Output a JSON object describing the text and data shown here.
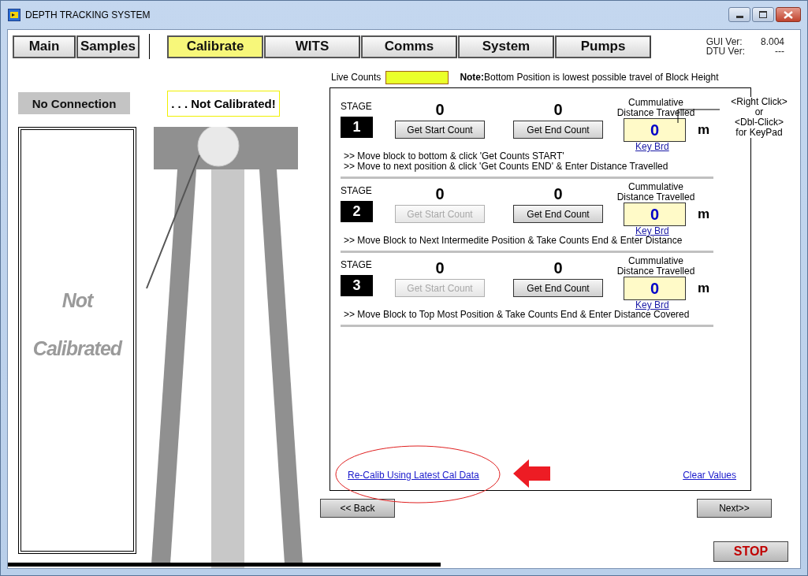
{
  "window": {
    "title": "DEPTH TRACKING SYSTEM"
  },
  "tab_groups": [
    {
      "tabs": [
        {
          "label": "Main",
          "selected": false
        },
        {
          "label": "Samples",
          "selected": false
        }
      ]
    },
    {
      "tabs": [
        {
          "label": "Calibrate",
          "selected": true
        },
        {
          "label": "WITS",
          "selected": false
        },
        {
          "label": "Comms",
          "selected": false
        },
        {
          "label": "System",
          "selected": false
        },
        {
          "label": "Pumps",
          "selected": false
        }
      ]
    }
  ],
  "versions": [
    {
      "label": "GUI Ver:",
      "value": "8.004"
    },
    {
      "label": "DTU Ver:",
      "value": "---"
    }
  ],
  "connection_status": "No Connection",
  "calibration_status": ". . . Not Calibrated!",
  "gauge_panel": {
    "lines": [
      "Not",
      "Calibrated"
    ]
  },
  "live_counts": {
    "label": "Live Counts"
  },
  "note": "**Note:**Bottom Position is lowest possible travel of Block Height",
  "callout": [
    "<Right Click>",
    "or",
    "<Dbl-Click>",
    "for KeyPad"
  ],
  "stages": [
    {
      "label": "STAGE",
      "number": "1",
      "start_count": "0",
      "end_count": "0",
      "start_button": {
        "label": "Get Start Count",
        "disabled": false
      },
      "end_button": {
        "label": "Get End Count",
        "disabled": false
      },
      "distance_label": "Cummulative Distance Travelled",
      "distance": "0",
      "unit": "m",
      "keyboard_link": "Key Brd",
      "instructions": [
        ">> Move block to bottom & click 'Get Counts START'",
        ">> Move to next position & click 'Get Counts END' & Enter Distance Travelled"
      ]
    },
    {
      "label": "STAGE",
      "number": "2",
      "start_count": "0",
      "end_count": "0",
      "start_button": {
        "label": "Get Start Count",
        "disabled": true
      },
      "end_button": {
        "label": "Get End Count",
        "disabled": false
      },
      "distance_label": "Cummulative Distance Travelled",
      "distance": "0",
      "unit": "m",
      "keyboard_link": "Key Brd",
      "instructions": [
        ">> Move Block to Next Intermedite Position & Take Counts End & Enter Distance"
      ]
    },
    {
      "label": "STAGE",
      "number": "3",
      "start_count": "0",
      "end_count": "0",
      "start_button": {
        "label": "Get Start Count",
        "disabled": true
      },
      "end_button": {
        "label": "Get End Count",
        "disabled": false
      },
      "distance_label": "Cummulative Distance Travelled",
      "distance": "0",
      "unit": "m",
      "keyboard_link": "Key Brd",
      "instructions": [
        ">> Move Block to Top Most Position & Take Counts End & Enter Distance Covered"
      ]
    }
  ],
  "links": {
    "recalib": "Re-Calib Using Latest Cal Data",
    "clear": "Clear Values"
  },
  "buttons": {
    "back": "<< Back",
    "next": "Next>>",
    "stop": "STOP"
  }
}
